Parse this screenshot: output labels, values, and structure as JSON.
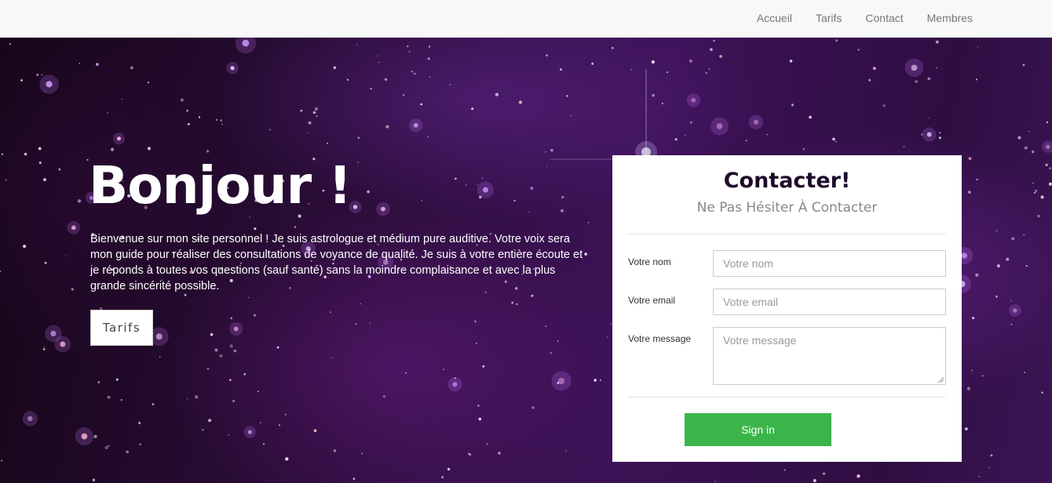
{
  "nav": {
    "items": [
      {
        "label": "Accueil"
      },
      {
        "label": "Tarifs"
      },
      {
        "label": "Contact"
      },
      {
        "label": "Membres"
      }
    ]
  },
  "hero": {
    "title": "Bonjour !",
    "text": "Bienvenue sur mon site personnel ! Je suis astrologue et médium pure auditive. Votre voix sera mon guide pour réaliser des consultations de voyance de qualité. Je suis à votre entière écoute et je réponds à toutes vos questions (sauf santé) sans la moindre complaisance et avec la plus grande sincérité possible.",
    "button_label": "Tarifs"
  },
  "contact_form": {
    "title": "Contacter!",
    "subtitle": "Ne Pas Hésiter À Contacter",
    "fields": [
      {
        "label": "Votre nom",
        "placeholder": "Votre nom",
        "value": ""
      },
      {
        "label": "Votre email",
        "placeholder": "Votre email",
        "value": ""
      },
      {
        "label": "Votre message",
        "placeholder": "Votre message",
        "value": ""
      }
    ],
    "submit_label": "Sign in"
  },
  "colors": {
    "nav_bg": "#f8f8f8",
    "hero_bg": "#2c0d3a",
    "accent_green": "#3bb54a",
    "title_dark": "#1e0b2b"
  }
}
